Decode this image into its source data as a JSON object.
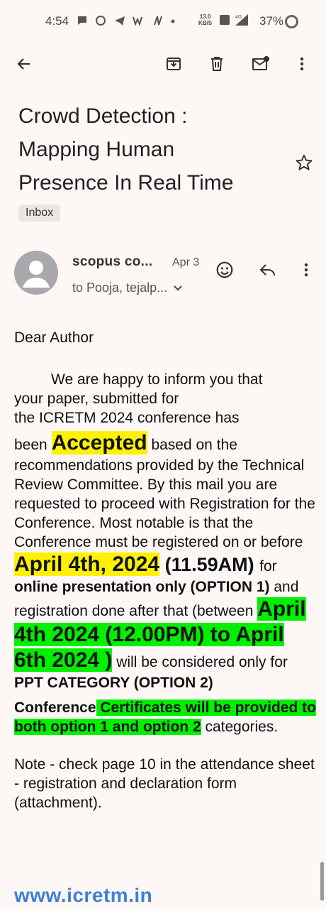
{
  "status_bar": {
    "time": "4:54",
    "netspeed_value": "13.0",
    "netspeed_unit": "KB/S",
    "network": "4G",
    "battery": "37%",
    "icons": [
      "chat-icon",
      "whatsapp-icon",
      "telegram-icon",
      "wifi-calling-icon",
      "nfc-icon",
      "dot-icon",
      "lte-icon",
      "signal-icon",
      "battery-icon"
    ]
  },
  "toolbar": {
    "icons": [
      "back-arrow-icon",
      "archive-icon",
      "delete-icon",
      "mark-unread-icon",
      "more-vert-icon"
    ]
  },
  "email": {
    "subject_line1": "Crowd Detection :",
    "subject_line2": "Mapping Human",
    "subject_line3": "Presence In Real Time",
    "label": "Inbox",
    "sender": "scopus co...",
    "date": "Apr 3",
    "recipients": "to Pooja, tejalp...",
    "header_icons": [
      "emoji-reaction-icon",
      "reply-icon",
      "more-vert-icon"
    ]
  },
  "body": {
    "greeting": "Dear Author",
    "p1_indent": "We are happy to inform you that",
    "p1_l2": "your paper, submitted for",
    "p1_l3": "the ICRETM 2024 conference has",
    "p1_been": "been ",
    "p1_accepted": "Accepted",
    "p1_after": " based on the recommendations provided by the Technical Review Committee. By this mail you are requested to proceed with Registration for the Conference. Most notable is that the Conference must be registered on or before ",
    "date1": "April 4th, 2024",
    "time1": " (11.59AM) ",
    "for_text": "for ",
    "online_option": "online presentation only (OPTION 1)",
    "and_text": "  and registration done after that (between ",
    "date2": "April 4th 2024 (12.00PM) to April 6th 2024 )",
    "ppt_prefix": " will be considered only for ",
    "ppt_option": "PPT CATEGORY  (OPTION 2)",
    "conf_label": "Conference",
    "certificates": " Certificates will be provided to both option 1 and option 2",
    "categories": " categories.",
    "note": "Note - check page 10 in the attendance sheet - registration and declaration form (attachment).",
    "website": "www.icretm.in"
  },
  "colors": {
    "background": "#fdf7f5",
    "highlight_yellow": "#fff200",
    "highlight_green": "#00f000",
    "link_blue": "#3b82d6"
  }
}
